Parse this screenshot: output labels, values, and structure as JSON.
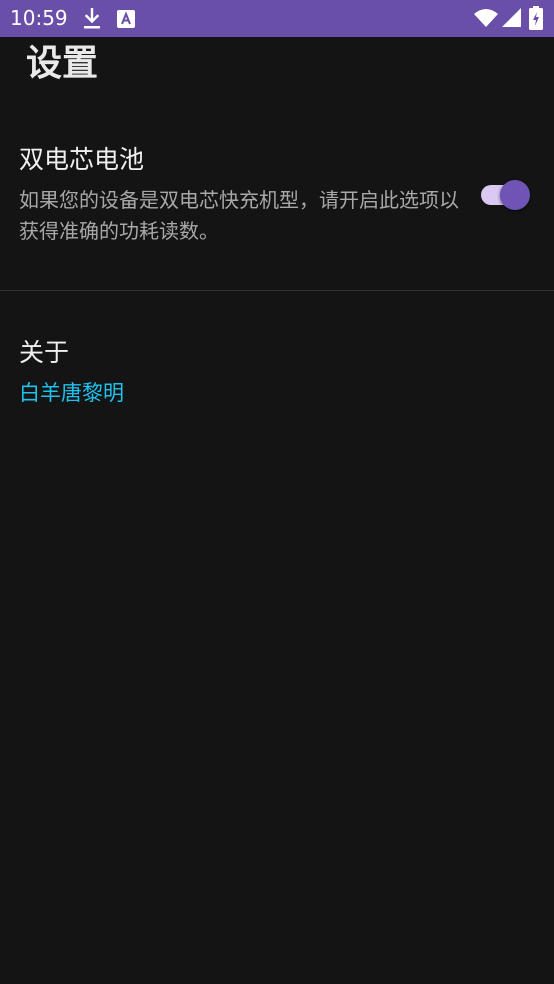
{
  "status_bar": {
    "time": "10:59",
    "icons": [
      "download-icon",
      "font-a-icon",
      "wifi-icon",
      "cell-signal-icon",
      "battery-charging-icon"
    ],
    "background": "#6a4fa8"
  },
  "settings": {
    "title": "设置"
  },
  "dual_cell": {
    "title": "双电芯电池",
    "summary": "如果您的设备是双电芯快充机型，请开启此选项以获得准确的功耗读数。",
    "enabled": true,
    "accent_color": "#6f54b6"
  },
  "about": {
    "title": "关于",
    "author": "白羊唐黎明",
    "link_color": "#1ec2ef"
  }
}
